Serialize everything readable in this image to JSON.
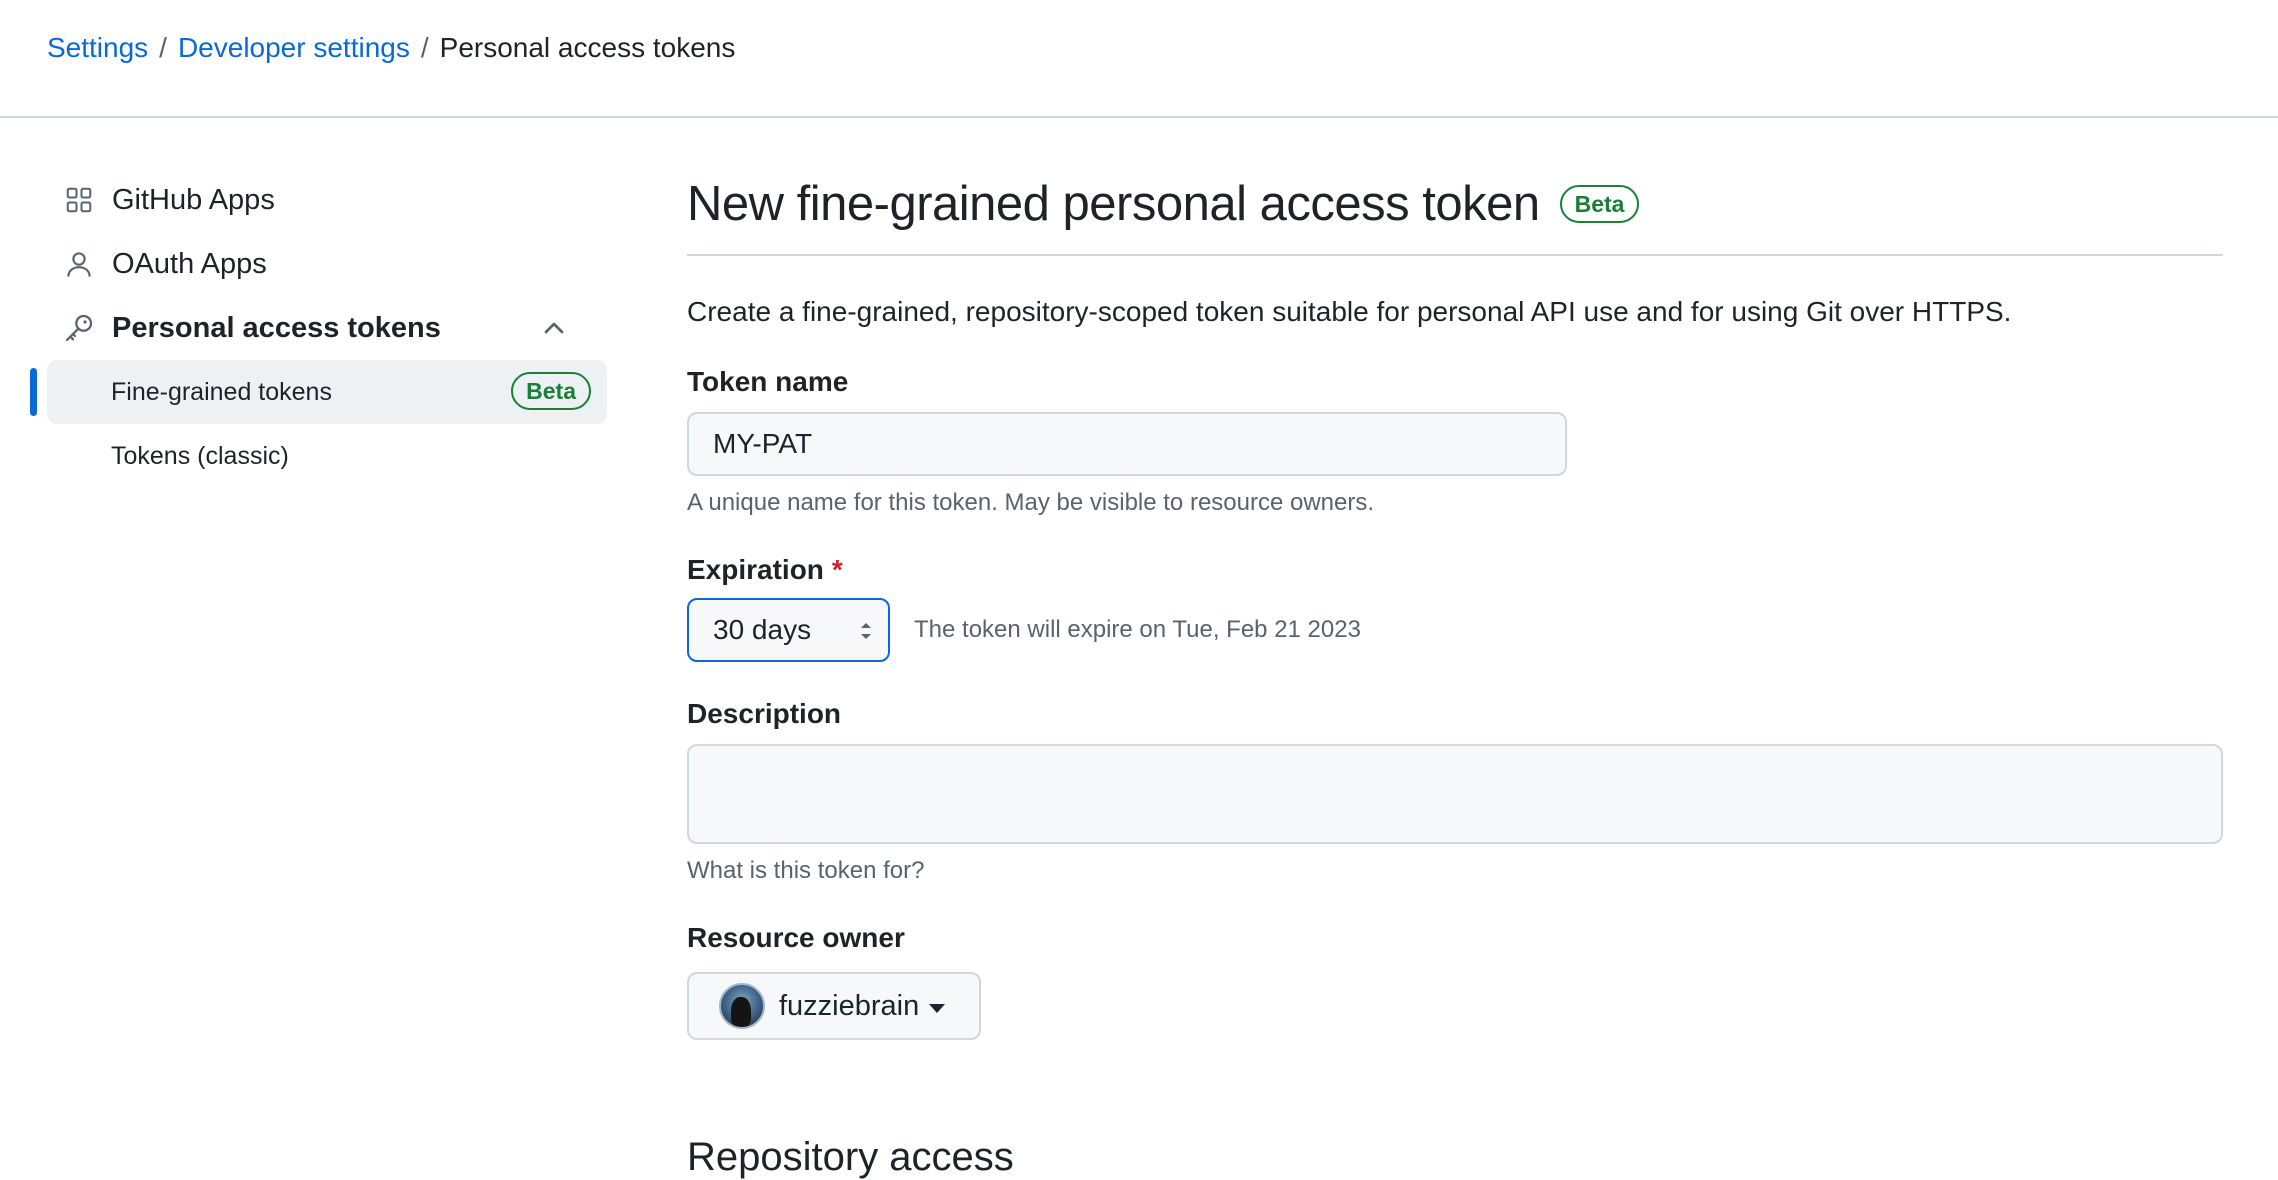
{
  "breadcrumb": {
    "items": [
      "Settings",
      "Developer settings"
    ],
    "current": "Personal access tokens",
    "separator": "/"
  },
  "sidebar": {
    "github_apps": "GitHub Apps",
    "oauth_apps": "OAuth Apps",
    "personal_access_tokens": "Personal access tokens",
    "fine_grained": "Fine-grained tokens",
    "fine_grained_badge": "Beta",
    "classic": "Tokens (classic)"
  },
  "main": {
    "title": "New fine-grained personal access token",
    "title_badge": "Beta",
    "intro": "Create a fine-grained, repository-scoped token suitable for personal API use and for using Git over HTTPS.",
    "token_name": {
      "label": "Token name",
      "value": "MY-PAT",
      "hint": "A unique name for this token. May be visible to resource owners."
    },
    "expiration": {
      "label": "Expiration",
      "required_mark": "*",
      "selected": "30 days",
      "note": "The token will expire on Tue, Feb 21 2023"
    },
    "description": {
      "label": "Description",
      "value": "",
      "hint": "What is this token for?"
    },
    "resource_owner": {
      "label": "Resource owner",
      "selected": "fuzziebrain"
    },
    "next_section": "Repository access"
  },
  "colors": {
    "link": "#0969da",
    "success": "#1a7f37",
    "danger": "#cf222e",
    "border": "#d0d7de"
  }
}
